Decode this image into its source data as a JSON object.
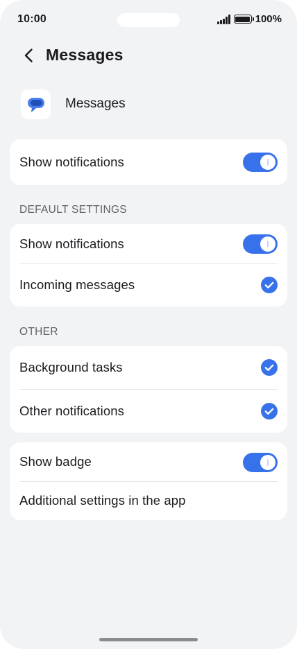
{
  "status_bar": {
    "time": "10:00",
    "battery_percent": "100%"
  },
  "header": {
    "title": "Messages",
    "back_icon": "chevron-left-icon"
  },
  "app": {
    "name": "Messages",
    "icon": "messages-app-icon",
    "accent": "#3872ea"
  },
  "main_card": {
    "show_notifications": {
      "label": "Show notifications",
      "on": true
    }
  },
  "default_settings": {
    "section_label": "DEFAULT SETTINGS",
    "show_notifications": {
      "label": "Show notifications",
      "on": true
    },
    "incoming_messages": {
      "label": "Incoming messages",
      "checked": true
    }
  },
  "other": {
    "section_label": "OTHER",
    "background_tasks": {
      "label": "Background tasks",
      "checked": true
    },
    "other_notifications": {
      "label": "Other notifications",
      "checked": true
    }
  },
  "extra": {
    "show_badge": {
      "label": "Show badge",
      "on": true
    },
    "additional_settings": {
      "label": "Additional settings in the app"
    }
  },
  "colors": {
    "toggle_on": "#3872ea",
    "background": "#f2f3f5",
    "card": "#ffffff"
  }
}
